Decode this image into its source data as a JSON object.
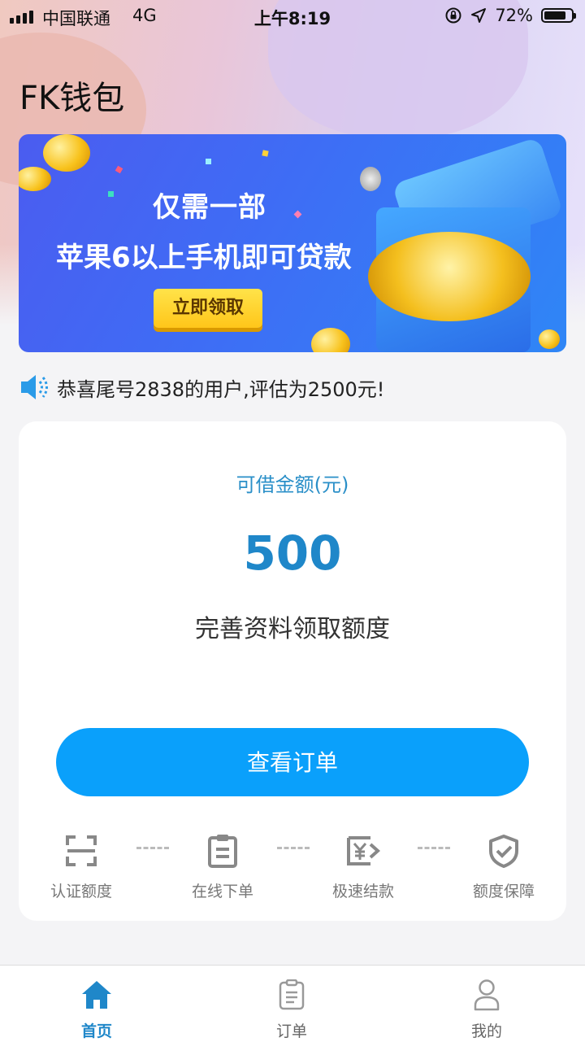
{
  "status_bar": {
    "carrier": "中国联通",
    "network": "4G",
    "time": "上午8:19",
    "battery": "72%",
    "battery_level": 0.72
  },
  "app_title": "FK钱包",
  "banner": {
    "line1": "仅需一部",
    "line2": "苹果6以上手机即可贷款",
    "button": "立即领取"
  },
  "notice": {
    "icon": "speaker-icon",
    "text": "恭喜尾号2838的用户,评估为2500元!"
  },
  "card": {
    "label": "可借金额(元)",
    "amount": "500",
    "subtitle": "完善资料领取额度",
    "button": "查看订单",
    "steps": [
      {
        "label": "认证额度",
        "icon": "scan-frame-icon"
      },
      {
        "label": "在线下单",
        "icon": "clipboard-icon"
      },
      {
        "label": "极速结款",
        "icon": "yen-transfer-icon"
      },
      {
        "label": "额度保障",
        "icon": "shield-check-icon"
      }
    ]
  },
  "tabbar": {
    "items": [
      {
        "label": "首页",
        "icon": "home-icon",
        "active": true
      },
      {
        "label": "订单",
        "icon": "order-icon",
        "active": false
      },
      {
        "label": "我的",
        "icon": "user-icon",
        "active": false
      }
    ]
  },
  "colors": {
    "accent": "#0aa0fb",
    "amount": "#1f87c9",
    "label": "#2a8fc8"
  }
}
